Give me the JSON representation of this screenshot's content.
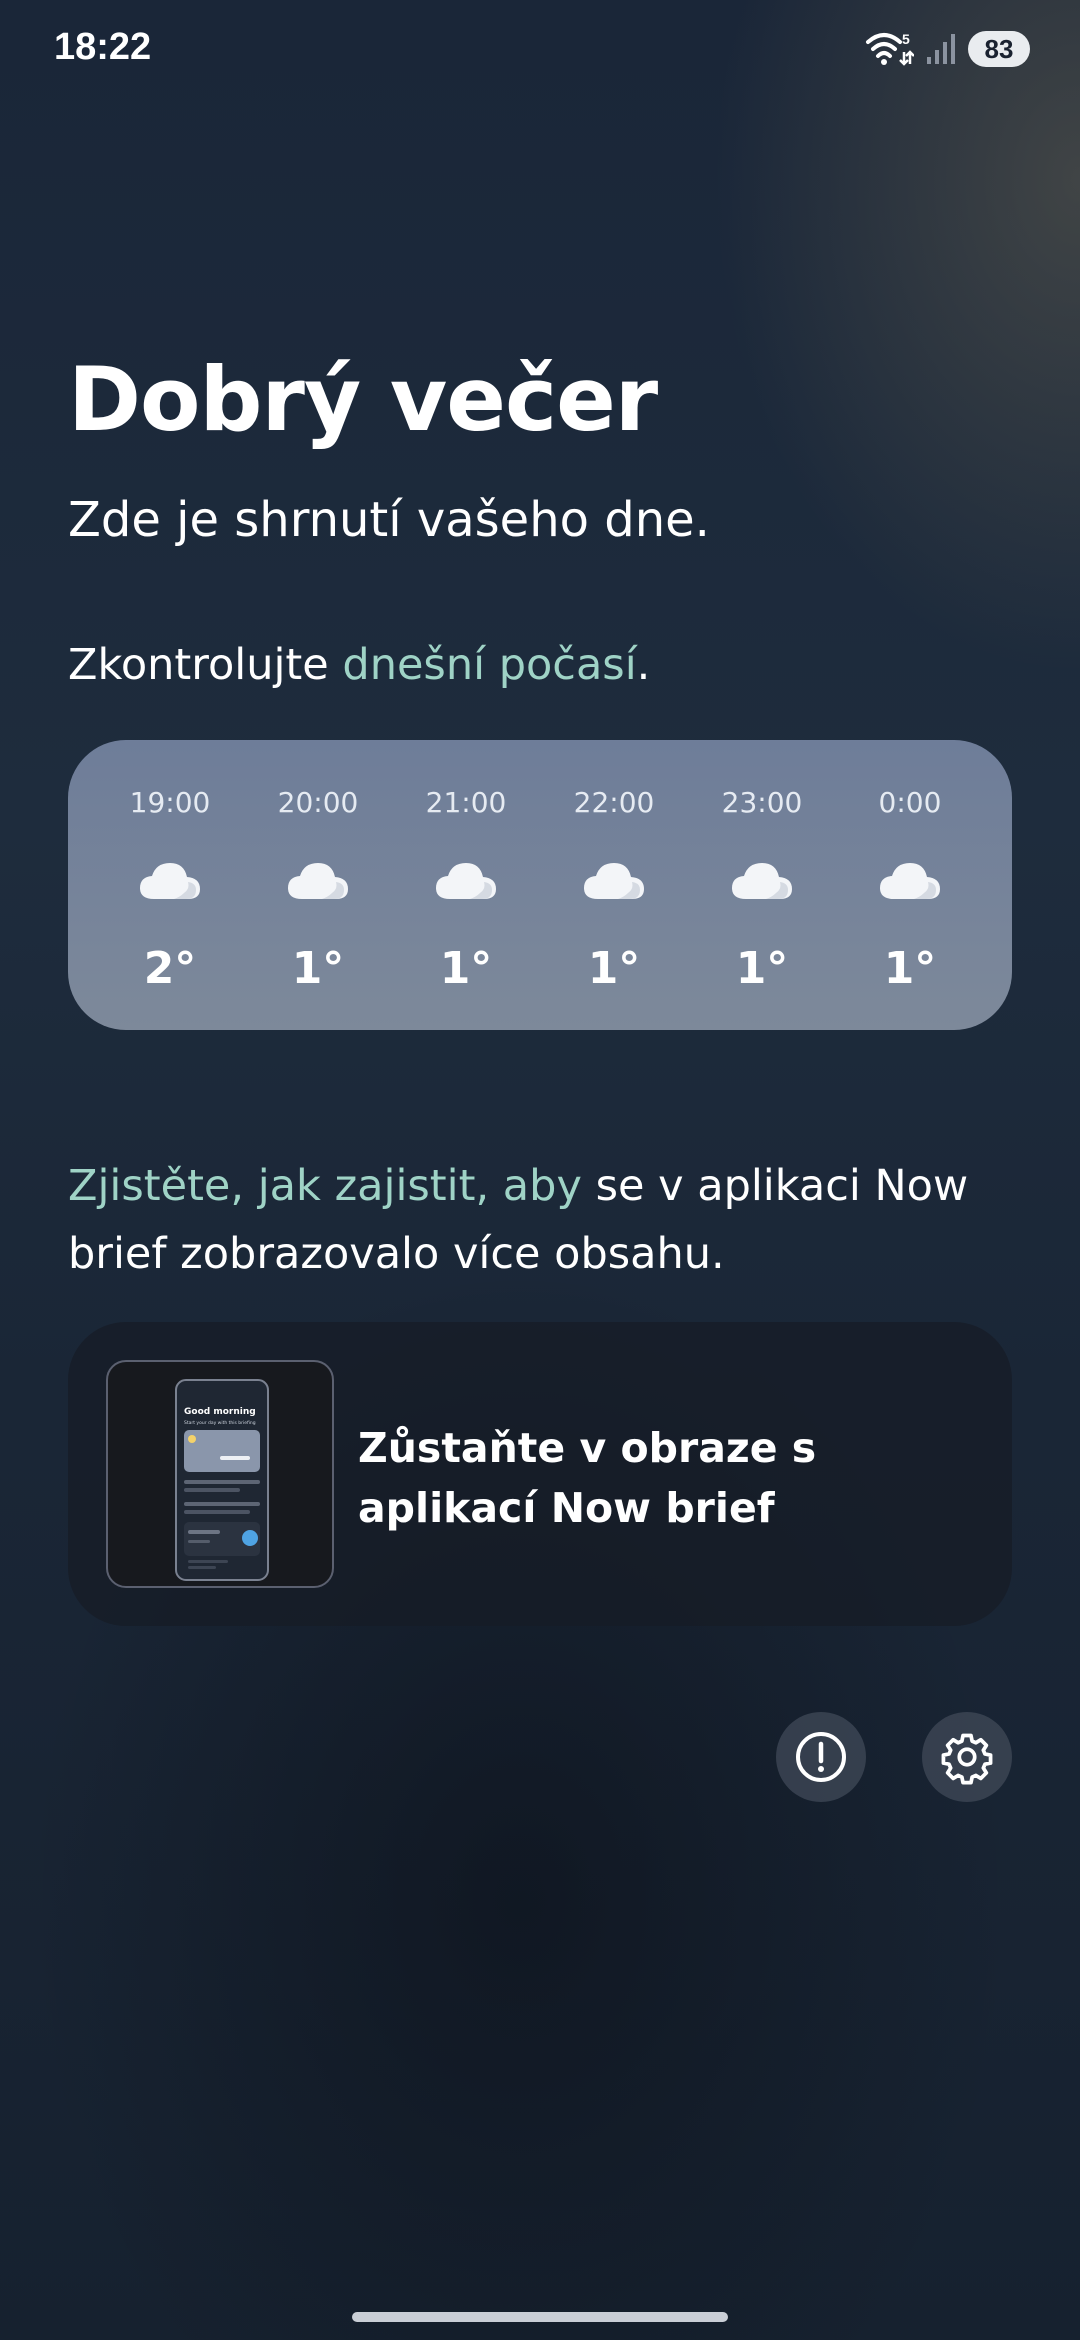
{
  "status_bar": {
    "time": "18:22",
    "network_badge": "5",
    "battery": "83",
    "icons": [
      "wifi-icon",
      "mobile-signal-icon",
      "battery-icon"
    ]
  },
  "greeting": "Dobrý večer",
  "subtitle": "Zde je shrnutí vašeho dne.",
  "weather_prompt": {
    "before": "Zkontrolujte ",
    "link": "dnešní počasí",
    "after": "."
  },
  "forecast": [
    {
      "time": "19:00",
      "icon": "cloud-icon",
      "temp": "2°"
    },
    {
      "time": "20:00",
      "icon": "cloud-icon",
      "temp": "1°"
    },
    {
      "time": "21:00",
      "icon": "cloud-icon",
      "temp": "1°"
    },
    {
      "time": "22:00",
      "icon": "cloud-icon",
      "temp": "1°"
    },
    {
      "time": "23:00",
      "icon": "cloud-icon",
      "temp": "1°"
    },
    {
      "time": "0:00",
      "icon": "cloud-icon",
      "temp": "1°"
    }
  ],
  "info": {
    "link": "Zjistěte, jak zajistit, aby",
    "rest": " se v aplikaci Now brief zobrazovalo více obsahu."
  },
  "brief_card": {
    "title": "Zůstaňte v obraze s aplikací Now brief",
    "thumbnail_heading": "Good morning",
    "thumbnail_subheading": "Start your day with this briefing"
  },
  "actions": {
    "feedback_icon": "alert-circle-icon",
    "settings_icon": "gear-icon"
  },
  "colors": {
    "accent": "#9fd3c6",
    "weather_card": "#76849a",
    "brief_card": "#1a212c"
  }
}
